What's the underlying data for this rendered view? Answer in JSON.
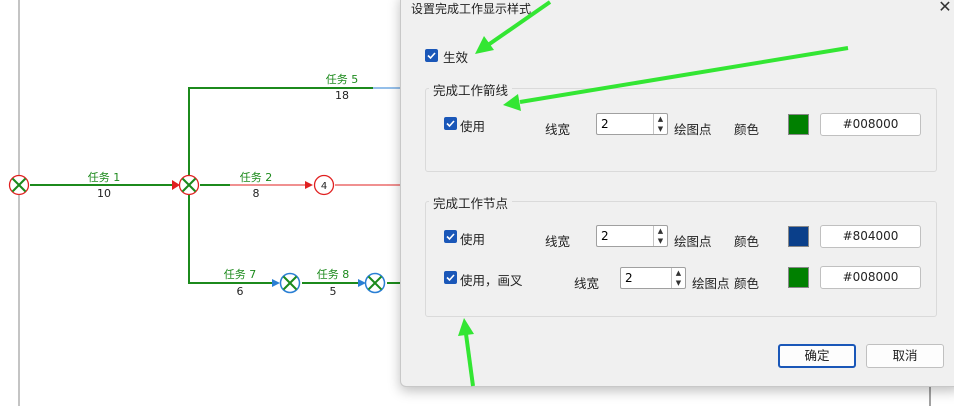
{
  "diagram": {
    "tasks": [
      {
        "name": "任务 1",
        "duration": "10"
      },
      {
        "name": "任务 2",
        "duration": "8"
      },
      {
        "name": "任务 5",
        "duration": "18"
      },
      {
        "name": "任务 7",
        "duration": "6"
      },
      {
        "name": "任务 8",
        "duration": "5"
      }
    ],
    "node_label": "4"
  },
  "dialog": {
    "title": "设置完成工作显示样式",
    "close_icon": "close-icon",
    "effective_label": "生效",
    "effective_checked": true,
    "arrow_group": {
      "title": "完成工作箭线",
      "use_label": "使用",
      "use_checked": true,
      "line_width_label": "线宽",
      "line_width_value": "2",
      "draw_points_label": "绘图点",
      "color_label": "颜色",
      "color_hex": "#008000",
      "swatch_color": "#008000"
    },
    "node_group": {
      "title": "完成工作节点",
      "use_label": "使用",
      "use_checked": true,
      "line_width_label": "线宽",
      "line_width_value": "2",
      "draw_points_label": "绘图点",
      "color_label": "颜色",
      "color_hex": "#804000",
      "swatch_color": "#0a3f8a",
      "cross_label": "使用，画叉",
      "cross_checked": true,
      "cross_line_width_label": "线宽",
      "cross_line_width_value": "2",
      "cross_draw_points_label": "绘图点",
      "cross_color_label": "颜色",
      "cross_color_hex": "#008000",
      "cross_swatch_color": "#008000"
    },
    "ok_label": "确定",
    "cancel_label": "取消"
  },
  "colors": {
    "done_green": "#1c8a1c",
    "critical_red": "#e02020",
    "normal_blue": "#2a7fd4",
    "annotation_arrow": "#33e633",
    "accent": "#1a57b8"
  }
}
